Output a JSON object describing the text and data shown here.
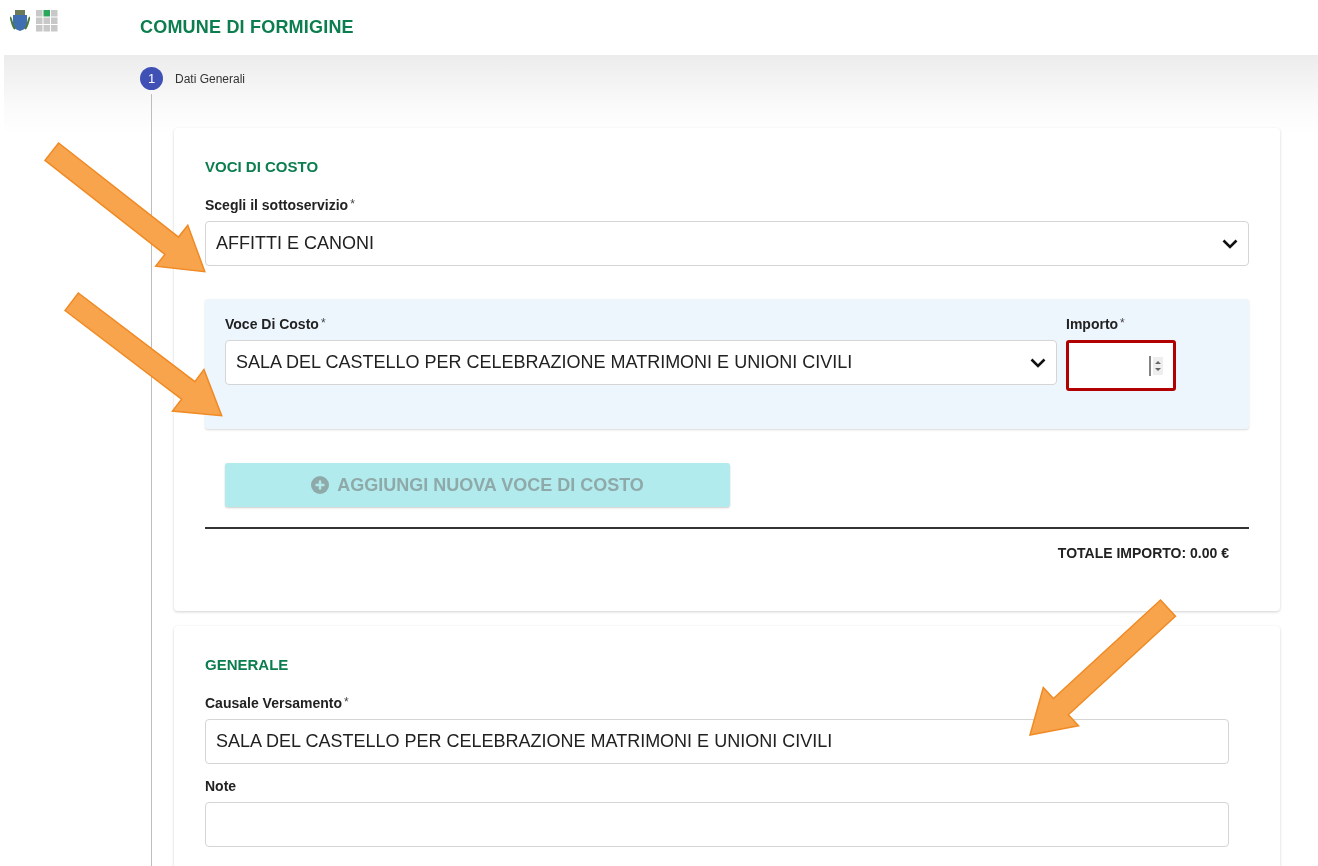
{
  "header": {
    "title": "COMUNE DI FORMIGINE"
  },
  "stepper": {
    "steps": [
      {
        "number": "1",
        "label": "Dati Generali",
        "selected": true
      }
    ]
  },
  "cost_card": {
    "title": "VOCI DI COSTO",
    "subservice": {
      "label": "Scegli il sottoservizio",
      "mark": "*",
      "value": "AFFITTI E CANONI"
    },
    "items": [
      {
        "cost_label": "Voce Di Costo",
        "cost_mark": "*",
        "cost_value": "SALA DEL CASTELLO PER CELEBRAZIONE MATRIMONI E UNIONI CIVILI",
        "amount_label": "Importo",
        "amount_mark": "*",
        "amount_error": true
      }
    ],
    "add_button": {
      "label": "AGGIUNGI NUOVA VOCE DI COSTO",
      "disabled": true
    },
    "total": "TOTALE IMPORTO: 0.00 €"
  },
  "general_card": {
    "title": "GENERALE",
    "fields": [
      {
        "label": "Causale Versamento",
        "mark": "*",
        "value": "SALA DEL CASTELLO PER CELEBRAZIONE MATRIMONI E UNIONI CIVILI"
      },
      {
        "label": "Note"
      }
    ]
  }
}
